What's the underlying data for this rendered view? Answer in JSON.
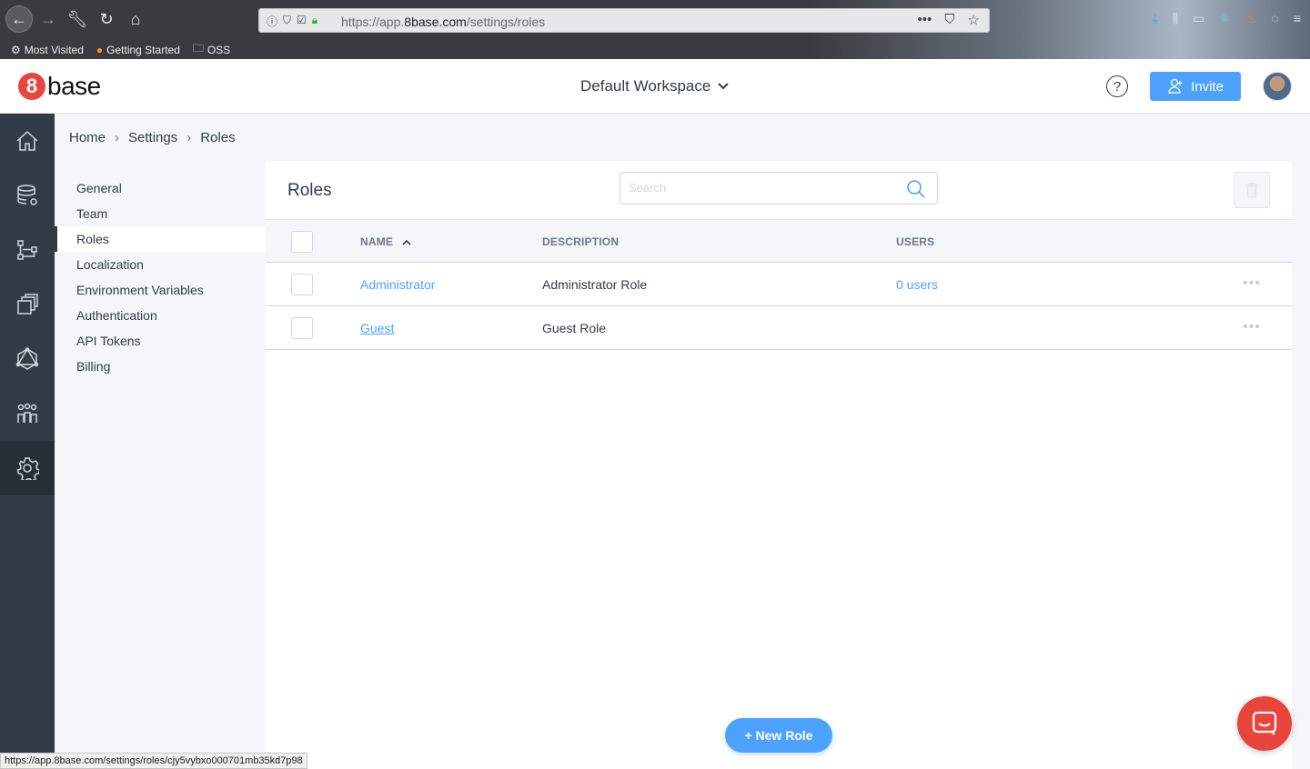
{
  "browser": {
    "url_prefix": "https://app.",
    "url_host": "8base.com",
    "url_path": "/settings/roles",
    "bookmarks": [
      "Most Visited",
      "Getting Started",
      "OSS"
    ]
  },
  "header": {
    "logo_text": "base",
    "logo_mark": "8",
    "workspace": "Default Workspace",
    "help_label": "?",
    "invite_label": "Invite"
  },
  "breadcrumb": [
    "Home",
    "Settings",
    "Roles"
  ],
  "settings_nav": [
    {
      "label": "General"
    },
    {
      "label": "Team"
    },
    {
      "label": "Roles",
      "active": true
    },
    {
      "label": "Localization"
    },
    {
      "label": "Environment Variables"
    },
    {
      "label": "Authentication"
    },
    {
      "label": "API Tokens"
    },
    {
      "label": "Billing"
    }
  ],
  "main": {
    "title": "Roles",
    "search_placeholder": "Search",
    "columns": [
      "NAME",
      "DESCRIPTION",
      "USERS"
    ],
    "rows": [
      {
        "name": "Administrator",
        "description": "Administrator Role",
        "users": "0 users"
      },
      {
        "name": "Guest",
        "description": "Guest Role",
        "users": ""
      }
    ],
    "new_role_label": "+ New Role"
  },
  "statusbar": "https://app.8base.com/settings/roles/cjy5vybxo000701mb35kd7p98",
  "colors": {
    "accent": "#4da1ff",
    "brand": "#e8453c",
    "sidebar": "#323c47"
  },
  "icons": {
    "leftnav": [
      "home-icon",
      "database-icon",
      "functions-icon",
      "app-builder-icon",
      "graphql-icon",
      "users-icon",
      "settings-icon"
    ]
  }
}
